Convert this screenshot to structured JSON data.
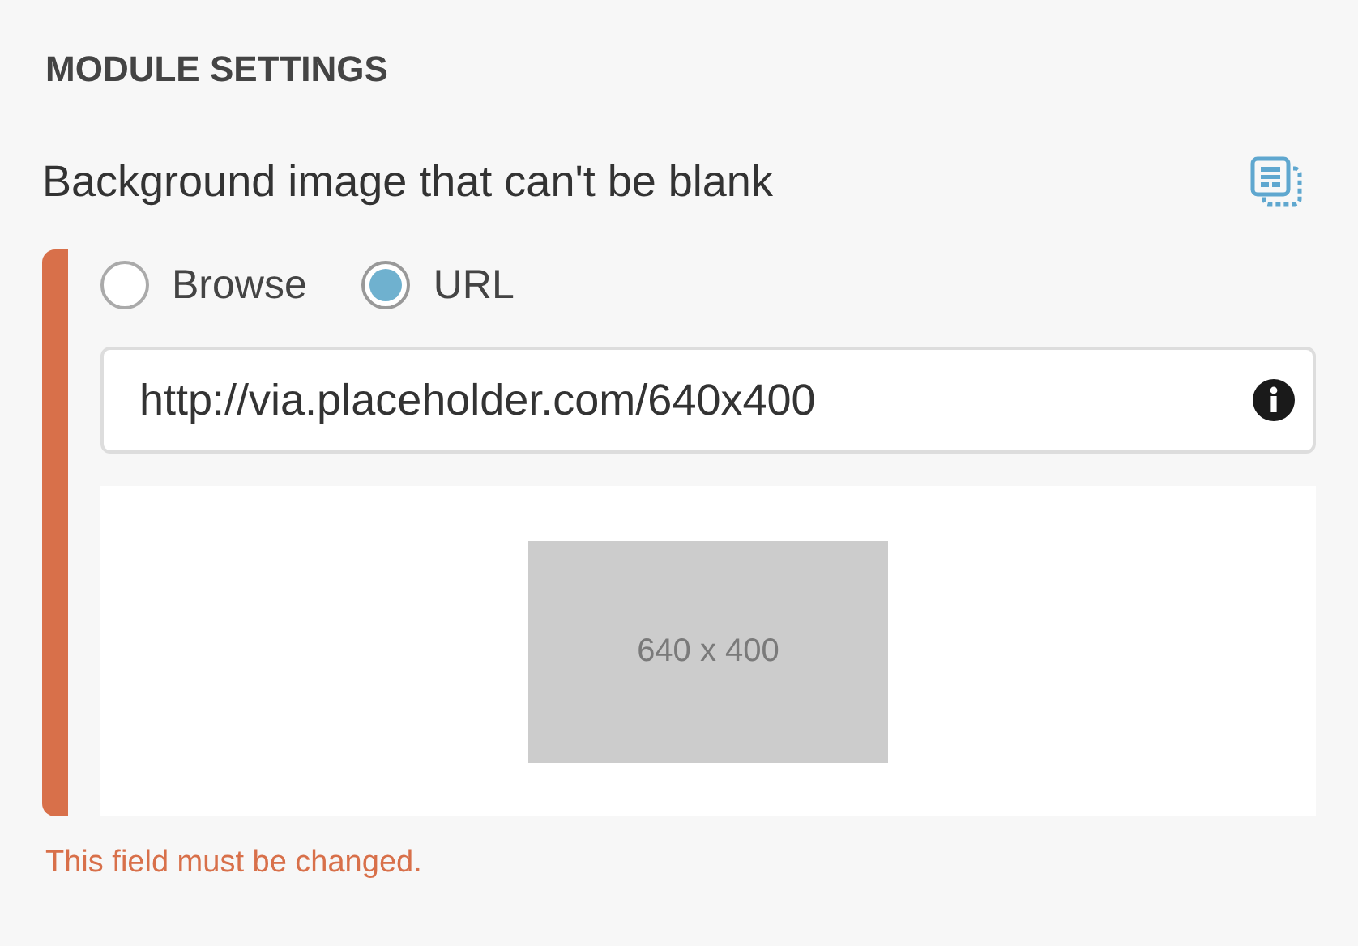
{
  "section_title": "MODULE SETTINGS",
  "field": {
    "label": "Background image that can't be blank",
    "invalid": true,
    "source_options": [
      {
        "label": "Browse",
        "selected": false
      },
      {
        "label": "URL",
        "selected": true
      }
    ],
    "url_value": "http://via.placeholder.com/640x400",
    "preview": {
      "text": "640 x 400"
    },
    "error": "This field must be changed."
  }
}
